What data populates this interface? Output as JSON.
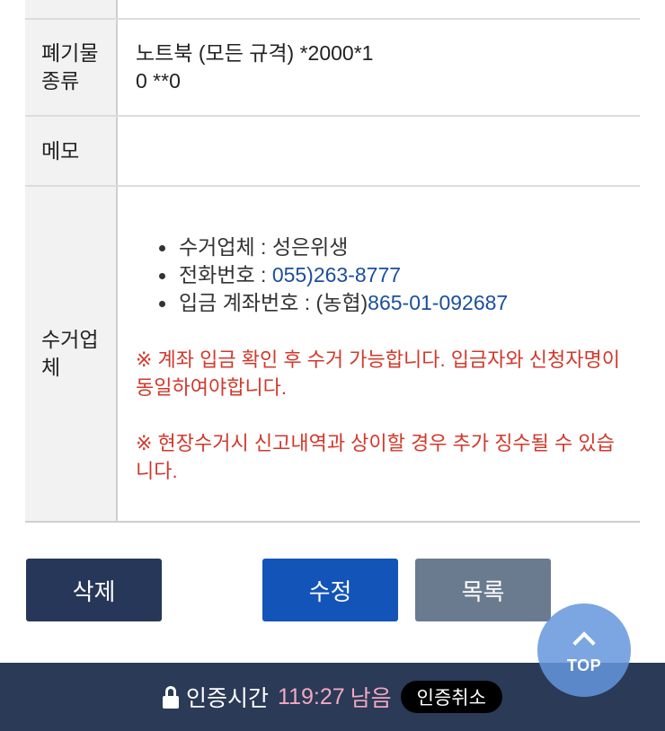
{
  "table": {
    "waste_type": {
      "label_line1": "폐기물",
      "label_line2": "종류",
      "value_line1": "노트북 (모든 규격) *2000*1",
      "value_line2": "0 **0"
    },
    "memo": {
      "label": "메모",
      "value": ""
    },
    "company": {
      "label_line1": "수거업",
      "label_line2": "체",
      "items": [
        {
          "label": "수거업체 : ",
          "value": "성은위생"
        },
        {
          "label": "전화번호 : ",
          "value": "055)263-8777"
        },
        {
          "label": "입금 계좌번호 : (농협)",
          "value": "865-01-092687"
        }
      ],
      "notice1": "※ 계좌 입금 확인 후 수거 가능합니다. 입금자와 신청자명이 동일하여야합니다.",
      "notice2": "※ 현장수거시 신고내역과 상이할 경우 추가 징수될 수 있습니다."
    }
  },
  "buttons": {
    "delete": "삭제",
    "edit": "수정",
    "list": "목록"
  },
  "top_button": {
    "label": "TOP",
    "icon": "chevron-up-icon"
  },
  "auth": {
    "icon": "lock-icon",
    "label": "인증시간",
    "time": "119:27",
    "remain": "남음",
    "cancel": "인증취소",
    "time_color": "#f3a8c0"
  },
  "colors": {
    "navy": "#263759",
    "blue": "#1354b8",
    "gray": "#6b7b8f",
    "notice_red": "#d2382b",
    "link_blue": "#1a4f9c"
  }
}
